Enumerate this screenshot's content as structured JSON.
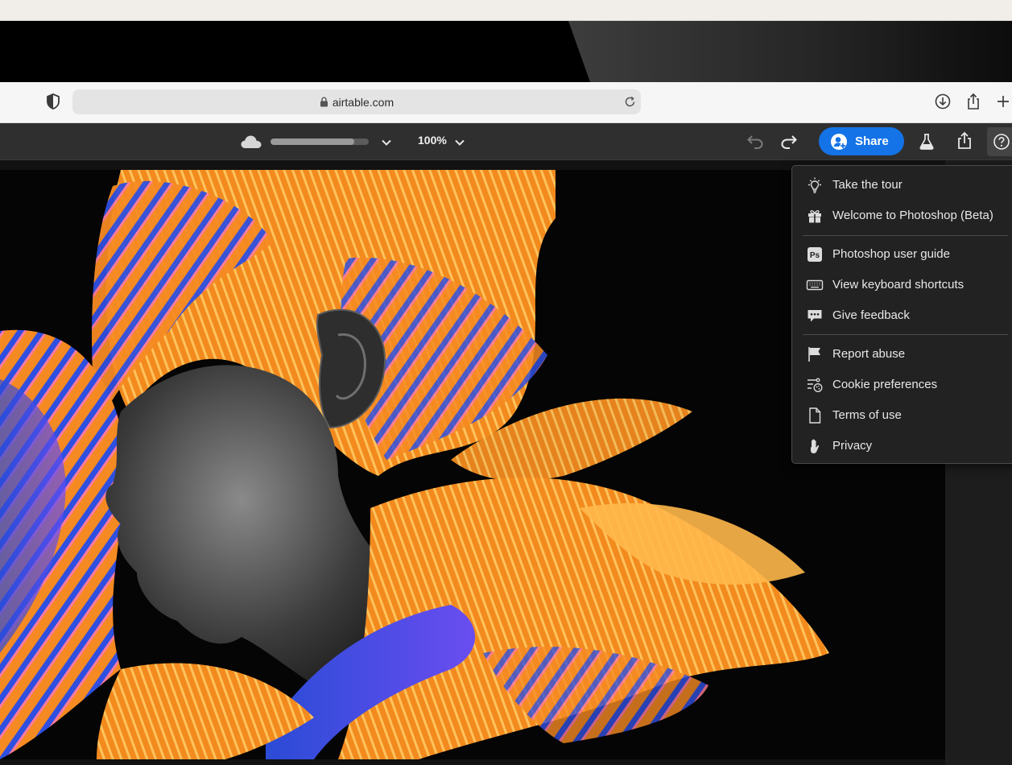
{
  "browser": {
    "url": "airtable.com"
  },
  "toolbar": {
    "zoom": "100%",
    "share_label": "Share",
    "progress_fraction": 0.85
  },
  "help_menu": {
    "sections": [
      [
        {
          "label": "Take the tour",
          "icon": "lightbulb-icon"
        },
        {
          "label": "Welcome to Photoshop (Beta)",
          "icon": "gift-icon"
        }
      ],
      [
        {
          "label": "Photoshop user guide",
          "icon": "ps-icon"
        },
        {
          "label": "View keyboard shortcuts",
          "icon": "keyboard-icon"
        },
        {
          "label": "Give feedback",
          "icon": "chat-bubble-icon"
        }
      ],
      [
        {
          "label": "Report abuse",
          "icon": "flag-icon"
        },
        {
          "label": "Cookie preferences",
          "icon": "cookie-settings-icon"
        },
        {
          "label": "Terms of use",
          "icon": "document-icon"
        },
        {
          "label": "Privacy",
          "icon": "hand-icon"
        }
      ]
    ]
  },
  "colors": {
    "accent": "#1473e6",
    "toolbar_bg": "#2f2f2f",
    "menu_bg": "#222222"
  }
}
